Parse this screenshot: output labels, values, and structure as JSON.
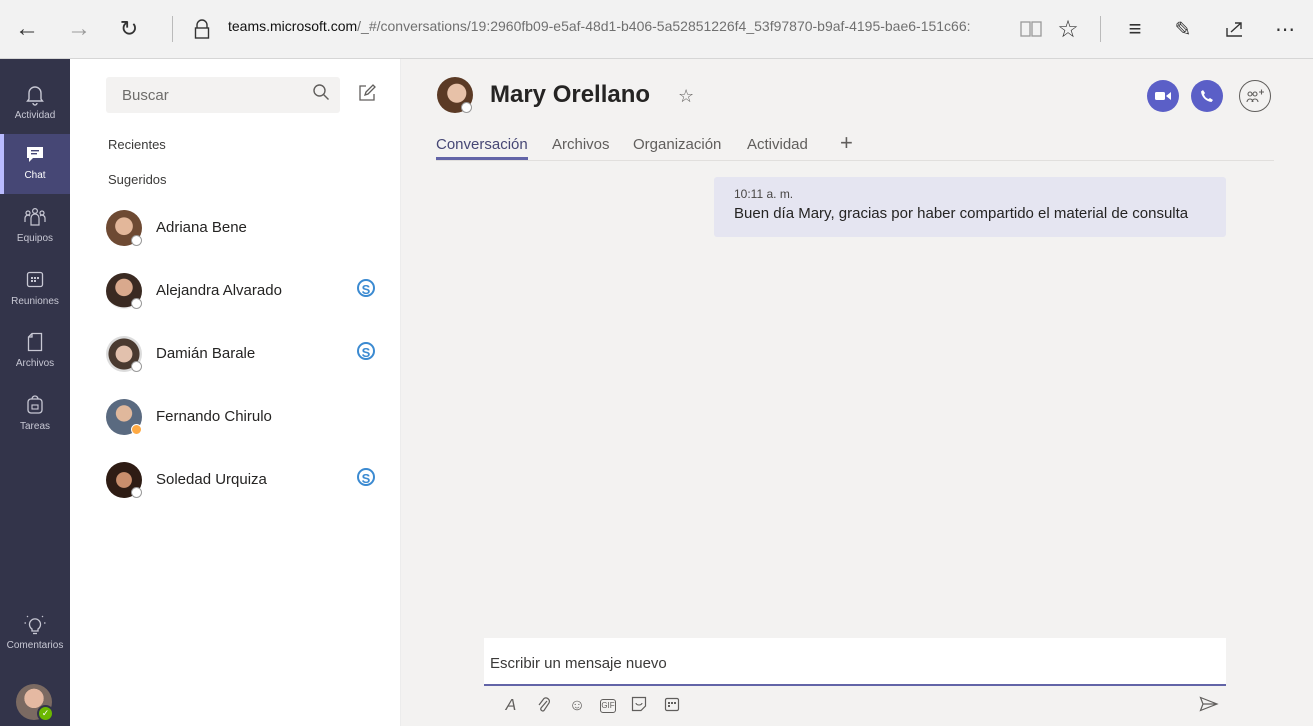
{
  "browser": {
    "url_host": "teams.microsoft.com",
    "url_path": "/_#/conversations/19:2960fb09-e5af-48d1-b406-5a52851226f4_53f97870-b9af-4195-bae6-151c66:",
    "icons": [
      "back-icon",
      "forward-icon",
      "refresh-icon",
      "lock-icon",
      "reading-view-icon",
      "favorite-star-icon",
      "hub-icon",
      "notes-pen-icon",
      "share-icon",
      "more-icon"
    ]
  },
  "rail": {
    "items": [
      {
        "label": "Actividad",
        "icon": "bell-icon"
      },
      {
        "label": "Chat",
        "icon": "chat-icon"
      },
      {
        "label": "Equipos",
        "icon": "teams-icon"
      },
      {
        "label": "Reuniones",
        "icon": "calendar-icon"
      },
      {
        "label": "Archivos",
        "icon": "file-icon"
      },
      {
        "label": "Tareas",
        "icon": "tasks-icon"
      }
    ],
    "feedback_label": "Comentarios"
  },
  "chatlist": {
    "search_placeholder": "Buscar",
    "recent_label": "Recientes",
    "suggested_label": "Sugeridos",
    "skype_glyph": "S",
    "contacts": [
      {
        "name": "Adriana Bene",
        "skype": false,
        "status": "offline"
      },
      {
        "name": "Alejandra Alvarado",
        "skype": true,
        "status": "offline"
      },
      {
        "name": "Damián Barale",
        "skype": true,
        "status": "offline"
      },
      {
        "name": "Fernando Chirulo",
        "skype": false,
        "status": "away"
      },
      {
        "name": "Soledad Urquiza",
        "skype": true,
        "status": "offline"
      }
    ]
  },
  "conversation": {
    "title": "Mary Orellano",
    "tabs": [
      "Conversación",
      "Archivos",
      "Organización",
      "Actividad"
    ],
    "active_tab": "Conversación",
    "message": {
      "time": "10:11 a. m.",
      "text": "Buen día Mary, gracias por haber compartido el material de consulta"
    },
    "composer_placeholder": "Escribir un mensaje nuevo",
    "gif_label": "GIF"
  },
  "colors": {
    "rail_bg": "#33344a",
    "accent": "#6264a7",
    "call_button": "#5b5fc7",
    "bubble_bg": "#e5e5f1",
    "main_bg": "#f3f2f1"
  }
}
